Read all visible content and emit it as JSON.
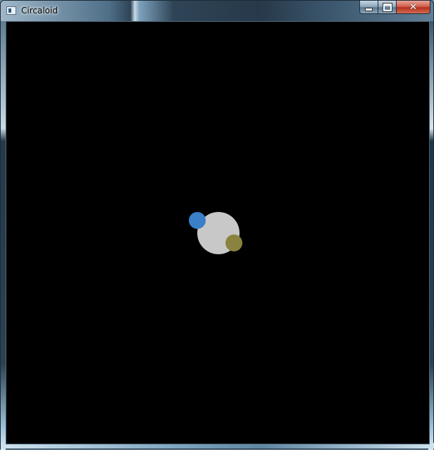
{
  "window": {
    "title": "Circaloid",
    "icon": "app-window-icon",
    "buttons": {
      "minimize_icon": "minimize-icon",
      "maximize_icon": "maximize-icon",
      "close_icon": "close-icon",
      "close_glyph": "✕"
    }
  },
  "game": {
    "background_color": "#000000",
    "planet": {
      "color": "#c8c8c8",
      "icon": "planet-circle"
    },
    "players": [
      {
        "color": "#3a7fc8",
        "icon": "blue-player-circle"
      },
      {
        "color": "#8a8340",
        "icon": "olive-player-circle"
      }
    ]
  }
}
